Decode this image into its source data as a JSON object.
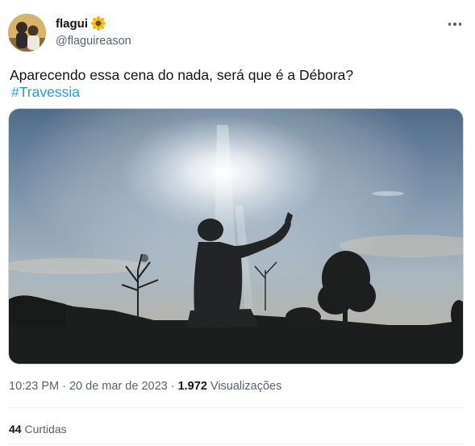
{
  "author": {
    "name": "flagui",
    "emoji_icon": "sunflower-icon",
    "handle": "@flaguireason"
  },
  "tweet": {
    "text": "Aparecendo essa cena do nada, será que é a Débora?",
    "hashtag": "#Travessia"
  },
  "meta": {
    "time": "10:23 PM",
    "separator1": " · ",
    "date": "20 de mar de 2023",
    "separator2": " · ",
    "views_count": "1.972",
    "views_label": "Visualizações"
  },
  "stats": {
    "likes_count": "44",
    "likes_label": "Curtidas"
  },
  "colors": {
    "link": "#1d9bf0",
    "secondary_text": "#536471",
    "primary_text": "#0f1419"
  }
}
